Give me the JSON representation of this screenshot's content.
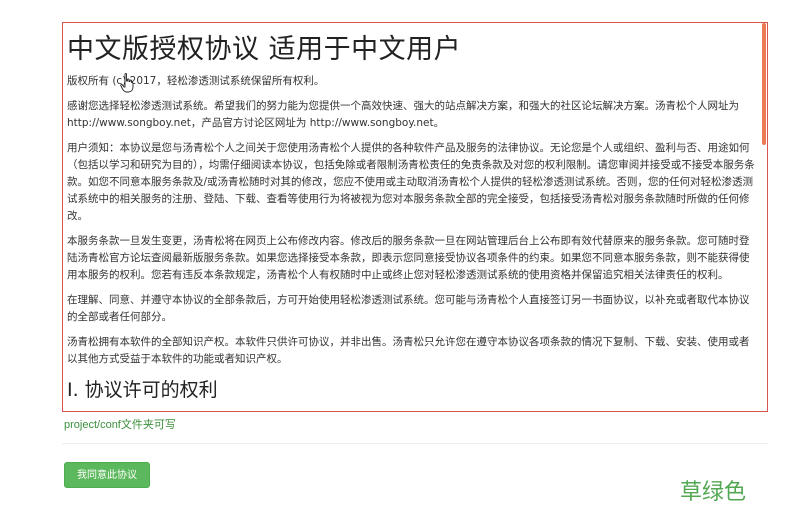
{
  "license": {
    "title": "中文版授权协议 适用于中文用户",
    "copyright": "版权所有 (c) 2017，轻松渗透测试系统保留所有权利。",
    "paragraphs": [
      "感谢您选择轻松渗透测试系统。希望我们的努力能为您提供一个高效快速、强大的站点解决方案，和强大的社区论坛解决方案。汤青松个人网址为 http://www.songboy.net，产品官方讨论区网址为 http://www.songboy.net。",
      "用户须知：本协议是您与汤青松个人之间关于您使用汤青松个人提供的各种软件产品及服务的法律协议。无论您是个人或组织、盈利与否、用途如何（包括以学习和研究为目的），均需仔细阅读本协议，包括免除或者限制汤青松责任的免责条款及对您的权利限制。请您审阅并接受或不接受本服务条款。如您不同意本服务条款及/或汤青松随时对其的修改，您应不使用或主动取消汤青松个人提供的轻松渗透测试系统。否则，您的任何对轻松渗透测试系统中的相关服务的注册、登陆、下载、查看等使用行为将被视为您对本服务条款全部的完全接受，包括接受汤青松对服务条款随时所做的任何修改。",
      "本服务条款一旦发生变更，汤青松将在网页上公布修改内容。修改后的服务条款一旦在网站管理后台上公布即有效代替原来的服务条款。您可随时登陆汤青松官方论坛查阅最新版服务条款。如果您选择接受本条款，即表示您同意接受协议各项条件的约束。如果您不同意本服务条款，则不能获得使用本服务的权利。您若有违反本条款规定，汤青松个人有权随时中止或终止您对轻松渗透测试系统的使用资格并保留追究相关法律责任的权利。",
      "在理解、同意、并遵守本协议的全部条款后，方可开始使用轻松渗透测试系统。您可能与汤青松个人直接签订另一书面协议，以补充或者取代本协议的全部或者任何部分。",
      "汤青松拥有本软件的全部知识产权。本软件只供许可协议，并非出售。汤青松只允许您在遵守本协议各项条款的情况下复制、下载、安装、使用或者以其他方式受益于本软件的功能或者知识产权。"
    ],
    "section_title": "I. 协议许可的权利"
  },
  "writable_note": "project/conf文件夹可写",
  "agree_button_label": "我同意此协议",
  "annotation": "草绿色",
  "colors": {
    "box_border": "#d9534f",
    "button_bg": "#5cb85c",
    "note_text": "#3c8f3c",
    "annotation_text": "#52a852"
  }
}
